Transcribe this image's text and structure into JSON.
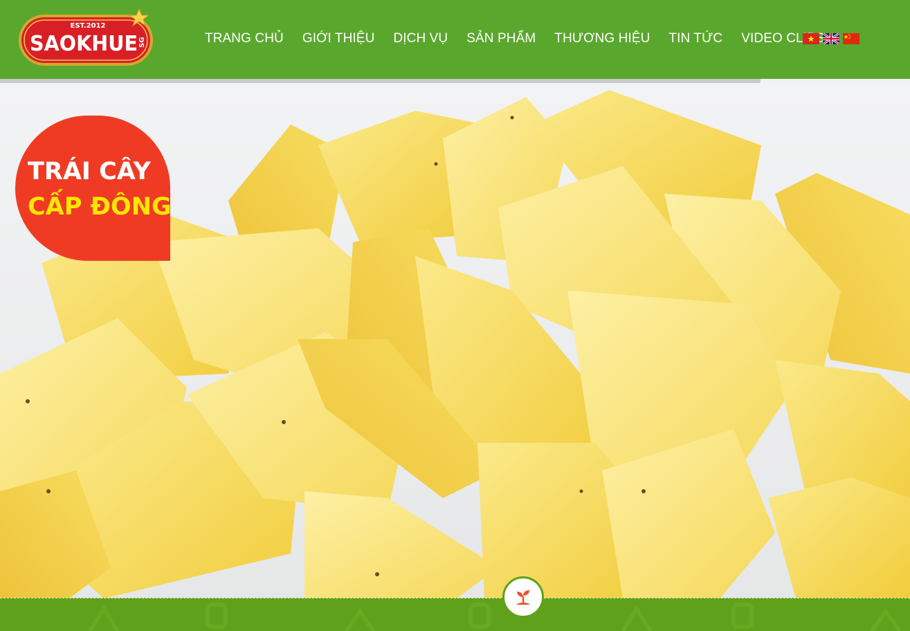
{
  "brand": {
    "logo_text": "SAOKHUE",
    "logo_est": "EST.2012",
    "logo_suffix": "SG"
  },
  "nav": {
    "items": [
      {
        "label": "TRANG CHỦ"
      },
      {
        "label": "GIỚI THIỆU"
      },
      {
        "label": "DỊCH VỤ"
      },
      {
        "label": "SẢN PHẨM"
      },
      {
        "label": "THƯƠNG HIỆU"
      },
      {
        "label": "TIN TỨC"
      },
      {
        "label": "VIDEO CLIPS"
      }
    ],
    "languages": [
      {
        "icon": "vietnam-flag-icon"
      },
      {
        "icon": "uk-flag-icon"
      },
      {
        "icon": "china-flag-icon"
      }
    ]
  },
  "slider": {
    "progress": 0.836
  },
  "hero": {
    "badge_line1": "TRÁI CÂY",
    "badge_line2": "CẤP ĐÔNG"
  },
  "footer": {
    "icon": "sprout-icon"
  },
  "colors": {
    "header_green": "#5aa72d",
    "badge_red": "#ef3b24",
    "badge_yellow": "#ffe600",
    "footer_green": "#5fa11a"
  }
}
